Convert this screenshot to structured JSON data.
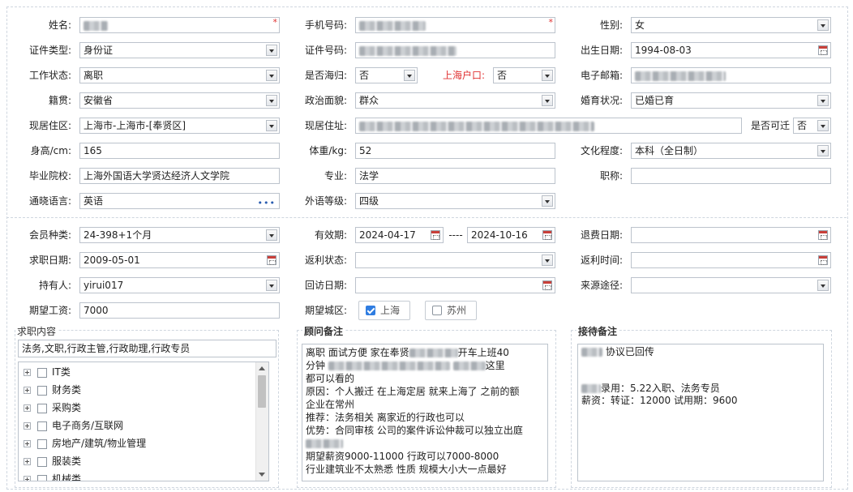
{
  "profile": {
    "name_label": "姓名:",
    "phone_label": "手机号码:",
    "gender_label": "性别:",
    "gender_value": "女",
    "id_type_label": "证件类型:",
    "id_type_value": "身份证",
    "id_number_label": "证件号码:",
    "birth_label": "出生日期:",
    "birth_value": "1994-08-03",
    "work_status_label": "工作状态:",
    "work_status_value": "离职",
    "returnee_label": "是否海归:",
    "returnee_value": "否",
    "shanghai_hukou_label": "上海户口:",
    "shanghai_hukou_value": "否",
    "email_label": "电子邮箱:",
    "native_label": "籍贯:",
    "native_value": "安徽省",
    "political_label": "政治面貌:",
    "political_value": "群众",
    "marital_label": "婚育状况:",
    "marital_value": "已婚已育",
    "residence_area_label": "现居住区:",
    "residence_area_value": "上海市-上海市-[奉贤区]",
    "address_label": "现居住址:",
    "relocate_label": "是否可迁",
    "relocate_value": "否",
    "height_label": "身高/cm:",
    "height_value": "165",
    "weight_label": "体重/kg:",
    "weight_value": "52",
    "education_label": "文化程度:",
    "education_value": "本科（全日制）",
    "school_label": "毕业院校:",
    "school_value": "上海外国语大学贤达经济人文学院",
    "major_label": "专业:",
    "major_value": "法学",
    "title_label": "职称:",
    "title_value": "",
    "language_label": "通晓语言:",
    "language_value": "英语",
    "language_more": "•••",
    "foreign_level_label": "外语等级:",
    "foreign_level_value": "四级"
  },
  "membership": {
    "member_type_label": "会员种类:",
    "member_type_value": "24-398+1个月",
    "validity_label": "有效期:",
    "validity_from": "2024-04-17",
    "validity_sep": "----",
    "validity_to": "2024-10-16",
    "refund_date_label": "退费日期:",
    "job_date_label": "求职日期:",
    "job_date_value": "2009-05-01",
    "rebate_status_label": "返利状态:",
    "rebate_time_label": "返利时间:",
    "holder_label": "持有人:",
    "holder_value": "yirui017",
    "visit_date_label": "回访日期:",
    "source_label": "来源途径:",
    "salary_label": "期望工资:",
    "salary_value": "7000",
    "city_label": "期望城区:",
    "city_options": [
      {
        "label": "上海",
        "checked": true
      },
      {
        "label": "苏州",
        "checked": false
      }
    ]
  },
  "job_content": {
    "title": "求职内容",
    "selected_text": "法务,文职,行政主管,行政助理,行政专员",
    "categories": [
      "IT类",
      "财务类",
      "采购类",
      "电子商务/互联网",
      "房地产/建筑/物业管理",
      "服装类",
      "机械类"
    ]
  },
  "advisor_notes": {
    "title": "顾问备注",
    "lines": [
      "离职     面试方便    家在奉贤",
      "开车上班40",
      "分钟",
      "这里",
      "都可以看的",
      "原因：个人搬迁    在上海定居   就来上海了 之前的额",
      "企业在常州",
      "推荐：法务相关    离家近的行政也可以",
      "优势：合同审核   公司的案件诉讼仲裁可以独立出庭",
      "期望薪资9000-11000   行政可以7000-8000",
      "行业建筑业不太熟悉   性质   规模大小大一点最好"
    ]
  },
  "reception_notes": {
    "title": "接待备注",
    "line1": "协议已回传",
    "line2": "录用：5.22入职、法务专员",
    "line3": "薪资：转证：12000 试用期：9600"
  }
}
